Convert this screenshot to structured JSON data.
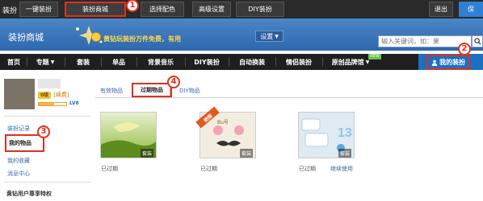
{
  "topbar": {
    "left_label": "装扮",
    "buttons": [
      "一键装扮",
      "装扮商城",
      "选择配色",
      "高级设置",
      "DIY装扮"
    ],
    "exit_label": "退出",
    "save_label": "保"
  },
  "header": {
    "brand": "装扮商城",
    "banner_text": "黄钻玩装扮万件免费，有用",
    "settings_label": "设置",
    "search_placeholder": "输入关键词，如：果"
  },
  "nav": {
    "items": [
      "首页",
      "专题",
      "套装",
      "单品",
      "背景音乐",
      "DIY装扮",
      "自动换装",
      "情侣装扮",
      "原创品牌馆"
    ],
    "new_badge": "NEW",
    "my_dressup": "我的装扮"
  },
  "sidebar": {
    "vip_badge": "0级",
    "renew_label": "[续费]",
    "level": "LV8",
    "links": [
      "装扮记录",
      "我的物品",
      "我的收藏",
      "消息中心"
    ],
    "footer": "黄钻用户尊享特权"
  },
  "tabs": [
    "有效物品",
    "过期物品",
    "DIY物品"
  ],
  "items": [
    {
      "tag": "套装",
      "status": "已过期",
      "action": ""
    },
    {
      "tag": "套装",
      "status": "已过期",
      "action": "",
      "ribbon": "绝版",
      "title": "Bu号"
    },
    {
      "tag": "套装",
      "status": "已过期",
      "action": "继续使用"
    }
  ],
  "callouts": [
    "1",
    "2",
    "3",
    "4"
  ],
  "colors": {
    "accent_red": "#e0301e",
    "header_blue": "#2f68ad",
    "nav_dark": "#1f1f1f",
    "link_blue": "#3a6aa8"
  }
}
